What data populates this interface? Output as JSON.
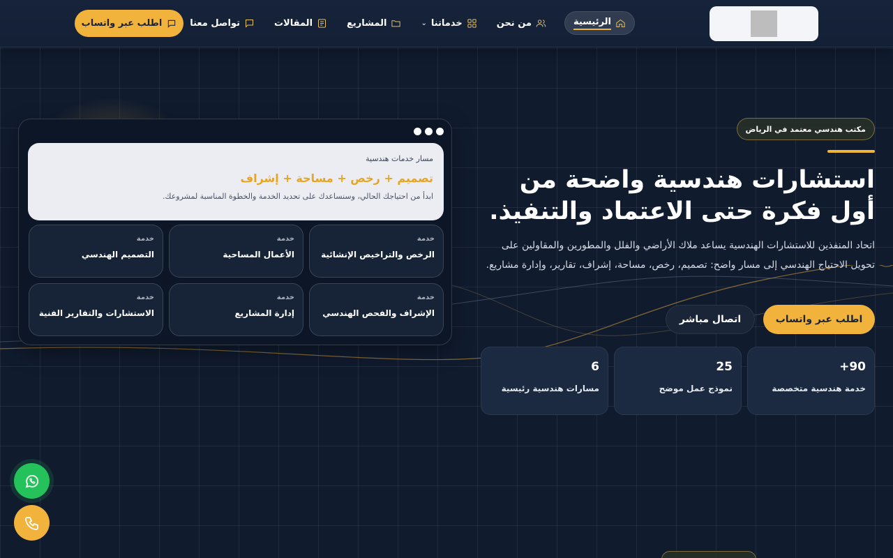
{
  "header": {
    "cta_label": "اطلب عبر واتساب",
    "nav": [
      {
        "label": "الرئيسية",
        "icon": "home-icon",
        "active": true
      },
      {
        "label": "من نحن",
        "icon": "users-icon"
      },
      {
        "label": "خدماتنا",
        "icon": "grid-icon",
        "dropdown": true
      },
      {
        "label": "المشاريع",
        "icon": "folder-icon"
      },
      {
        "label": "المقالات",
        "icon": "article-icon"
      },
      {
        "label": "تواصل معنا",
        "icon": "chat-icon"
      }
    ]
  },
  "hero": {
    "badge": "مكتب هندسي معتمد في الرياض",
    "title": "استشارات هندسية واضحة من أول فكرة حتى الاعتماد والتنفيذ.",
    "description": "اتحاد المنفذين للاستشارات الهندسية يساعد ملاك الأراضي والفلل والمطورين والمقاولين على تحويل الاحتياج الهندسي إلى مسار واضح: تصميم، رخص، مساحة، إشراف، تقارير، وإدارة مشاريع.",
    "primary_button": "اطلب عبر واتساب",
    "secondary_button": "اتصال مباشر",
    "stats": [
      {
        "value": "+90",
        "label": "خدمة هندسية متخصصة"
      },
      {
        "value": "25",
        "label": "نموذج عمل موضح"
      },
      {
        "value": "6",
        "label": "مسارات هندسية رئيسية"
      }
    ]
  },
  "panel": {
    "label": "مسار خدمات هندسية",
    "title": "تصميم + رخص + مساحة + إشراف",
    "description": "ابدأ من احتياجك الحالي، وسنساعدك على تحديد الخدمة والخطوة المناسبة لمشروعك.",
    "services": [
      {
        "tag": "خدمة",
        "name": "الرخص والتراخيص الإنشائية"
      },
      {
        "tag": "خدمة",
        "name": "الأعمال المساحية"
      },
      {
        "tag": "خدمة",
        "name": "التصميم الهندسي"
      },
      {
        "tag": "خدمة",
        "name": "الإشراف والفحص الهندسي"
      },
      {
        "tag": "خدمة",
        "name": "إدارة المشاريع"
      },
      {
        "tag": "خدمة",
        "name": "الاستشارات والتقارير الفنية"
      }
    ]
  },
  "floating": {
    "whatsapp_icon": "whatsapp-icon",
    "call_icon": "phone-icon"
  },
  "colors": {
    "accent": "#f2b33d",
    "background": "#101b2e",
    "whatsapp": "#25c25c"
  }
}
